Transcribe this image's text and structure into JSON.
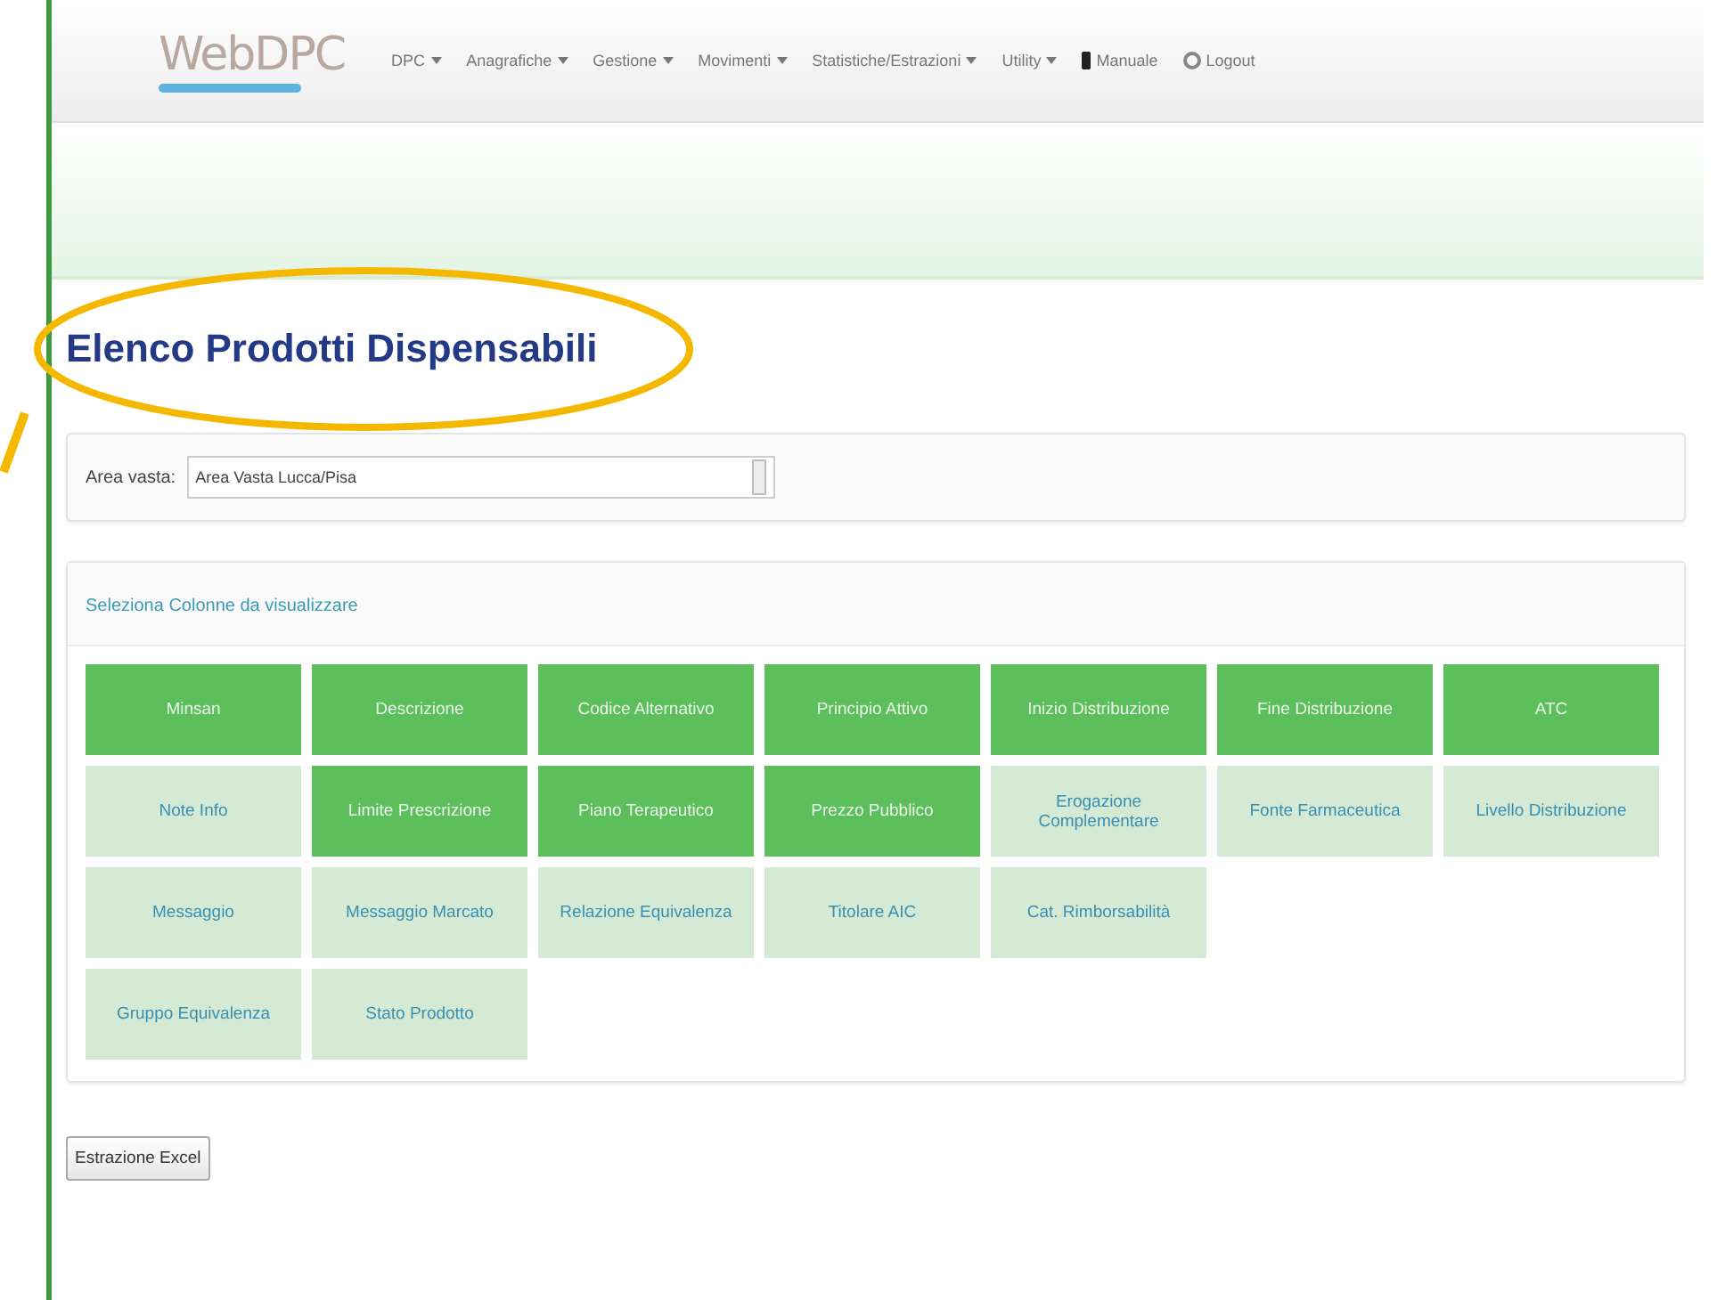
{
  "navbar": {
    "logo": "WebDPC",
    "menu": [
      {
        "label": "DPC",
        "dropdown": true
      },
      {
        "label": "Anagrafiche",
        "dropdown": true
      },
      {
        "label": "Gestione",
        "dropdown": true
      },
      {
        "label": "Movimenti",
        "dropdown": true
      },
      {
        "label": "Statistiche/Estrazioni",
        "dropdown": true
      },
      {
        "label": "Utility",
        "dropdown": true
      },
      {
        "label": "Manuale",
        "kind": "book"
      },
      {
        "label": "Logout",
        "kind": "power"
      }
    ]
  },
  "page_title": "Elenco Prodotti Dispensabili",
  "filter": {
    "label": "Area vasta:",
    "value": "Area Vasta Lucca/Pisa"
  },
  "columns_panel": {
    "link": "Seleziona Colonne da visualizzare",
    "rows": [
      [
        {
          "label": "Minsan",
          "selected": true
        },
        {
          "label": "Descrizione",
          "selected": true
        },
        {
          "label": "Codice Alternativo",
          "selected": true
        },
        {
          "label": "Principio Attivo",
          "selected": true
        },
        {
          "label": "Inizio Distribuzione",
          "selected": true
        },
        {
          "label": "Fine Distribuzione",
          "selected": true
        },
        {
          "label": "ATC",
          "selected": true
        }
      ],
      [
        {
          "label": "Note Info",
          "selected": false
        },
        {
          "label": "Limite Prescrizione",
          "selected": true
        },
        {
          "label": "Piano Terapeutico",
          "selected": true
        },
        {
          "label": "Prezzo Pubblico",
          "selected": true
        },
        {
          "label": "Erogazione Complementare",
          "selected": false
        },
        {
          "label": "Fonte Farmaceutica",
          "selected": false
        },
        {
          "label": "Livello Distribuzione",
          "selected": false
        }
      ],
      [
        {
          "label": "Messaggio",
          "selected": false
        },
        {
          "label": "Messaggio Marcato",
          "selected": false
        },
        {
          "label": "Relazione Equivalenza",
          "selected": false
        },
        {
          "label": "Titolare AIC",
          "selected": false
        },
        {
          "label": "Cat. Rimborsabilità",
          "selected": false
        }
      ],
      [
        {
          "label": "Gruppo Equivalenza",
          "selected": false
        },
        {
          "label": "Stato Prodotto",
          "selected": false
        }
      ]
    ]
  },
  "export_button": "Estrazione Excel"
}
